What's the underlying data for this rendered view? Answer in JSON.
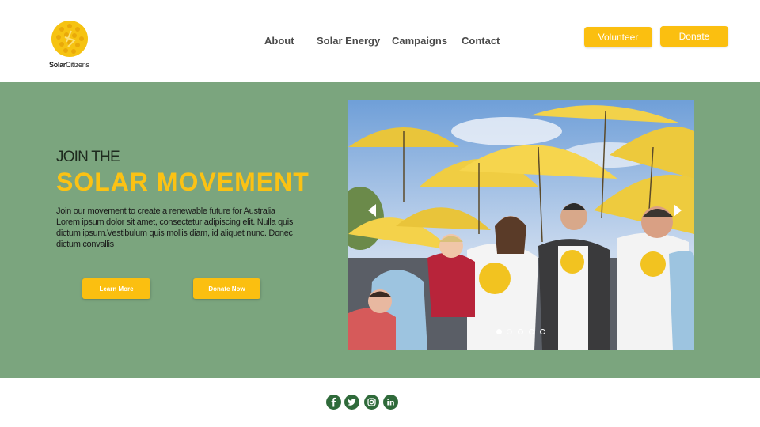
{
  "brand": {
    "logo_text_bold": "Solar",
    "logo_text_rest": "Citizens",
    "logo_icon": "sun-logo-icon",
    "accent_color": "#fbbf10",
    "hero_bg_color": "#7ba57e"
  },
  "nav": {
    "items": [
      {
        "label": "About"
      },
      {
        "label": "Solar Energy"
      },
      {
        "label": "Campaigns"
      },
      {
        "label": "Contact"
      }
    ],
    "volunteer_label": "Volunteer",
    "donate_label": "Donate"
  },
  "hero": {
    "pre_title": "JOIN THE",
    "title": "SOLAR MOVEMENT",
    "body": "Join our movement to create a renewable future for Australia Lorem ipsum dolor sit amet, consectetur adipiscing elit. Nulla quis dictum ipsum.Vestibulum quis mollis diam, id aliquet nunc. Donec dictum convallis",
    "learn_more_label": "Learn More",
    "donate_now_label": "Donate Now"
  },
  "slideshow": {
    "image": "people-with-yellow-umbrellas-photo",
    "prev_icon": "arrow-left-icon",
    "next_icon": "arrow-right-icon",
    "slide_count": 5,
    "active_slide": 1
  },
  "footer": {
    "social_icons": [
      "facebook-icon",
      "twitter-icon",
      "instagram-icon",
      "linkedin-icon"
    ]
  }
}
